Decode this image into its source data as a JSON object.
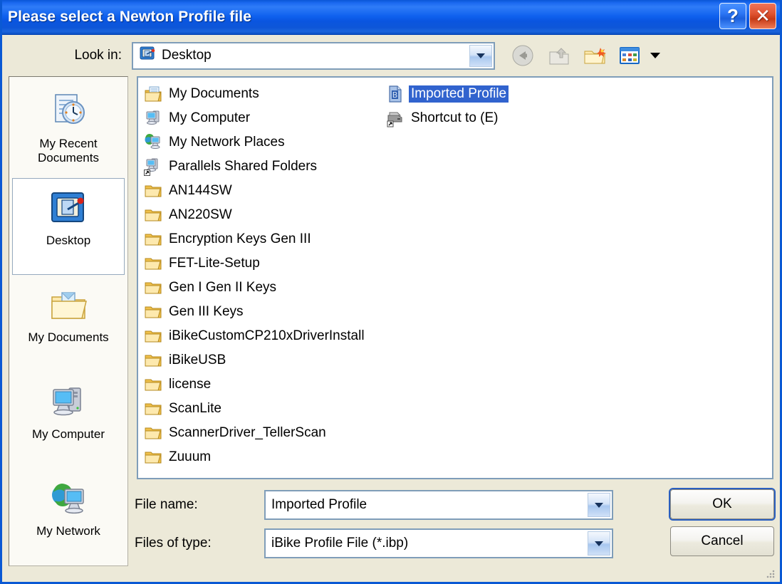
{
  "window": {
    "title": "Please select a Newton Profile file",
    "help_button": "?",
    "close_button": "✕",
    "accent_titlebar": "#0a56d6",
    "accent_selection": "#3163ce",
    "background": "#ece9d8"
  },
  "lookin": {
    "label": "Look in:",
    "value": "Desktop",
    "icon": "desktop-icon"
  },
  "toolbar": {
    "items": [
      {
        "name": "back-icon",
        "label": "Back",
        "enabled": false
      },
      {
        "name": "up-one-level-icon",
        "label": "Up One Level",
        "enabled": false
      },
      {
        "name": "create-new-folder-icon",
        "label": "Create New Folder",
        "enabled": true
      },
      {
        "name": "views-icon",
        "label": "Views",
        "enabled": true
      }
    ]
  },
  "places": {
    "items": [
      {
        "label": "My Recent Documents",
        "icon": "recent-documents-icon",
        "selected": false
      },
      {
        "label": "Desktop",
        "icon": "desktop-icon",
        "selected": true
      },
      {
        "label": "My Documents",
        "icon": "my-documents-icon",
        "selected": false
      },
      {
        "label": "My Computer",
        "icon": "my-computer-icon",
        "selected": false
      },
      {
        "label": "My Network",
        "icon": "my-network-icon",
        "selected": false
      }
    ]
  },
  "file_list": {
    "items": [
      {
        "name": "My Documents",
        "icon": "my-documents-folder-icon",
        "selected": false
      },
      {
        "name": "My Computer",
        "icon": "my-computer-icon",
        "selected": false
      },
      {
        "name": "My Network Places",
        "icon": "my-network-icon",
        "selected": false
      },
      {
        "name": "Parallels Shared Folders",
        "icon": "shared-folders-shortcut-icon",
        "selected": false
      },
      {
        "name": "AN144SW",
        "icon": "folder-icon",
        "selected": false
      },
      {
        "name": "AN220SW",
        "icon": "folder-icon",
        "selected": false
      },
      {
        "name": "Encryption Keys Gen III",
        "icon": "folder-icon",
        "selected": false
      },
      {
        "name": "FET-Lite-Setup",
        "icon": "folder-icon",
        "selected": false
      },
      {
        "name": "Gen I Gen II Keys",
        "icon": "folder-icon",
        "selected": false
      },
      {
        "name": "Gen III Keys",
        "icon": "folder-icon",
        "selected": false
      },
      {
        "name": "iBikeCustomCP210xDriverInstall",
        "icon": "folder-icon",
        "selected": false
      },
      {
        "name": "iBikeUSB",
        "icon": "folder-icon",
        "selected": false
      },
      {
        "name": "license",
        "icon": "folder-icon",
        "selected": false
      },
      {
        "name": "ScanLite",
        "icon": "folder-icon",
        "selected": false
      },
      {
        "name": "ScannerDriver_TellerScan",
        "icon": "folder-icon",
        "selected": false
      },
      {
        "name": "Zuuum",
        "icon": "folder-icon",
        "selected": false
      },
      {
        "name": "Imported Profile",
        "icon": "profile-file-icon",
        "selected": true
      },
      {
        "name": "Shortcut to (E)",
        "icon": "drive-shortcut-icon",
        "selected": false
      }
    ]
  },
  "form": {
    "filename_label": "File name:",
    "filename_value": "Imported Profile",
    "filename_placeholder": "",
    "filetype_label": "Files of type:",
    "filetype_value": "iBike Profile File (*.ibp)",
    "filetype_options": [
      "iBike Profile File (*.ibp)"
    ],
    "ok_label": "OK",
    "cancel_label": "Cancel"
  }
}
